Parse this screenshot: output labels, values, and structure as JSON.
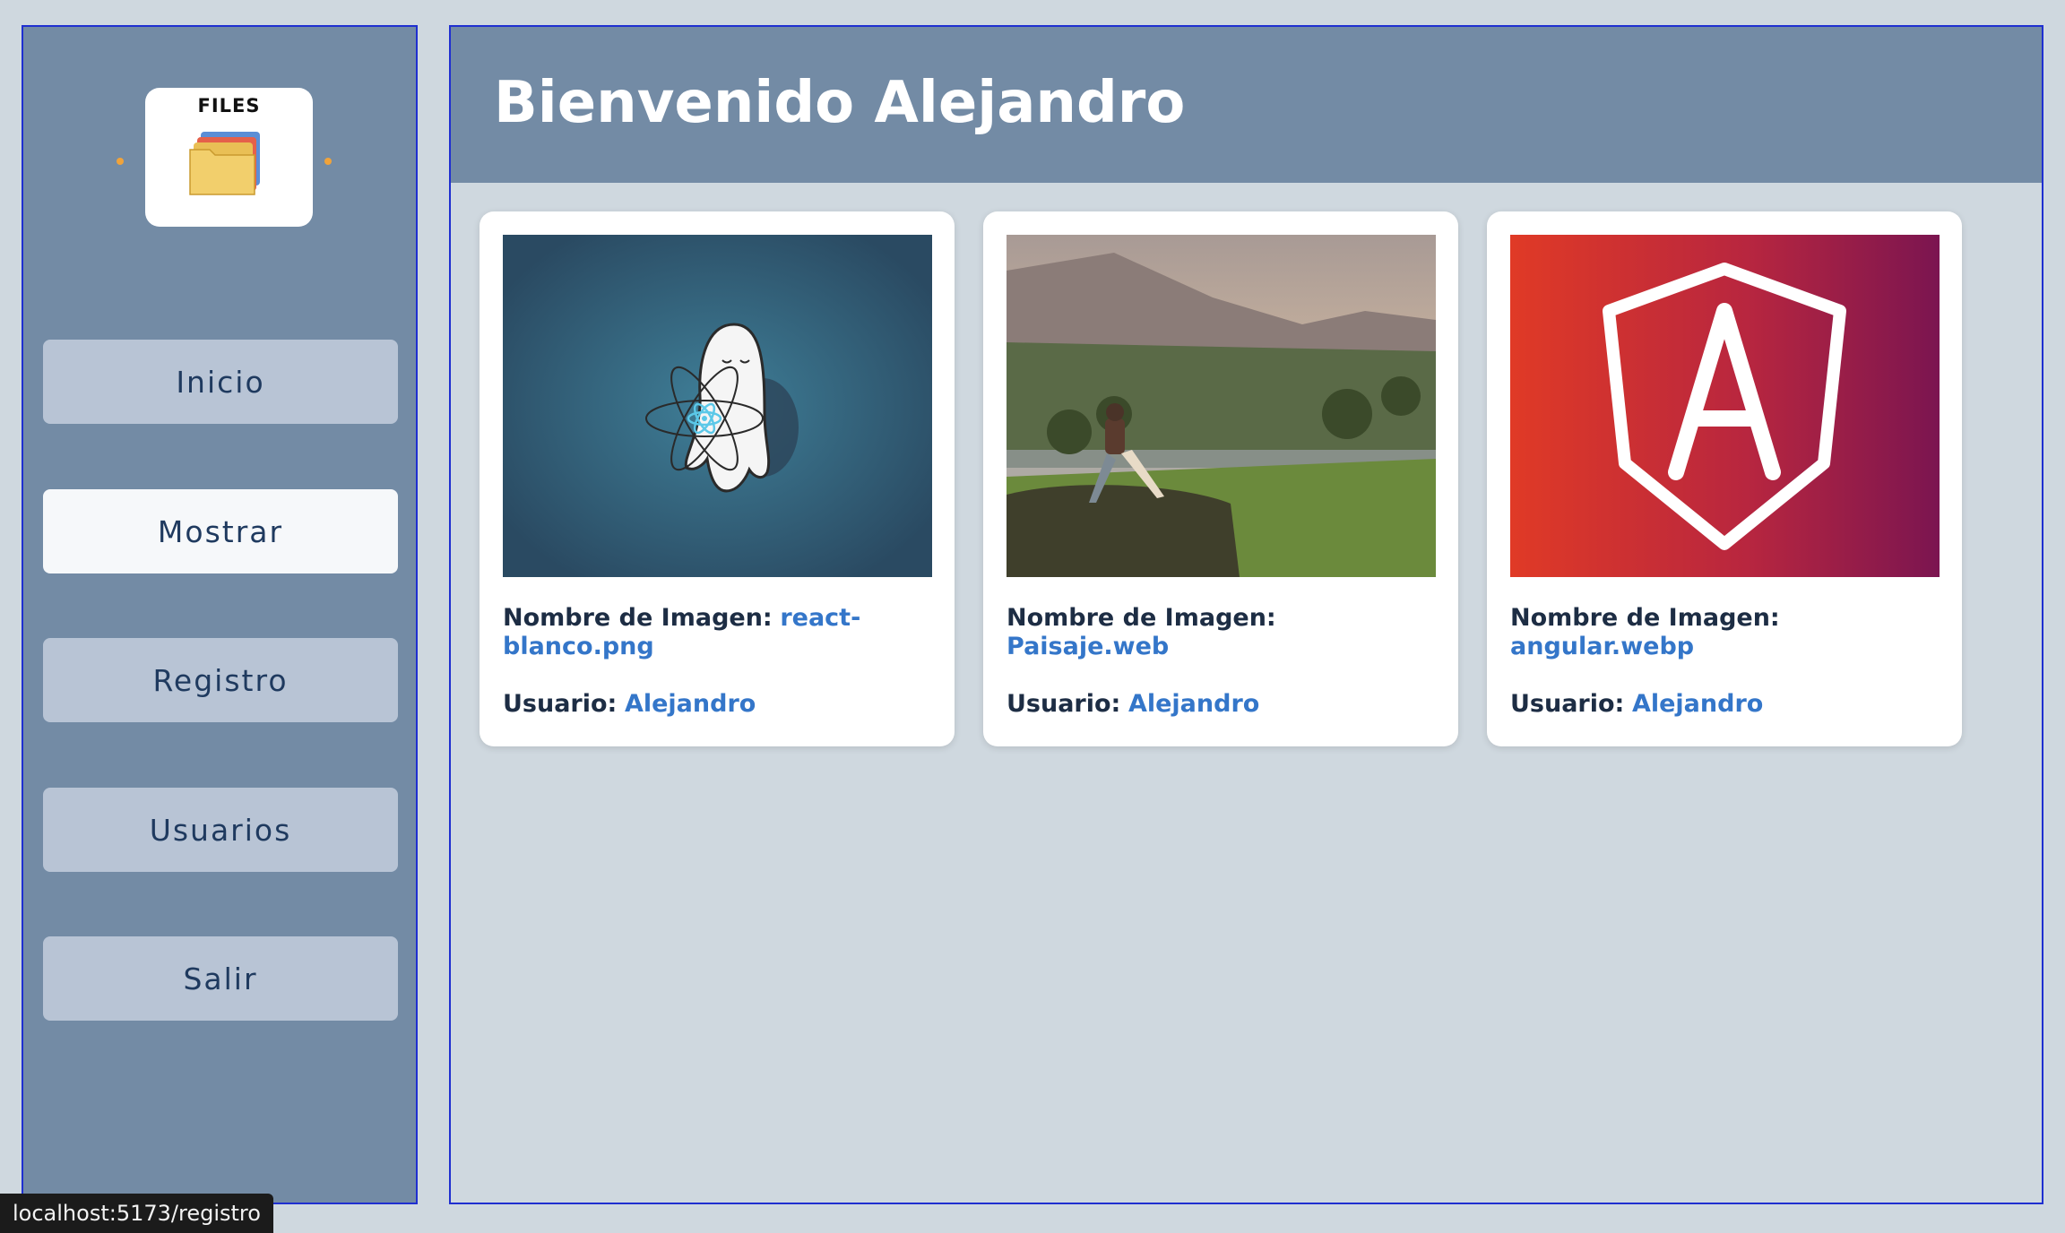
{
  "sidebar": {
    "logo_text": "FILES",
    "nav": [
      {
        "label": "Inicio"
      },
      {
        "label": "Mostrar",
        "active": true
      },
      {
        "label": "Registro"
      },
      {
        "label": "Usuarios"
      },
      {
        "label": "Salir"
      }
    ]
  },
  "header": {
    "title": "Bienvenido Alejandro"
  },
  "cards": [
    {
      "image_label": "Nombre de Imagen:",
      "image_name": "react-blanco.png",
      "user_label": "Usuario:",
      "user_name": "Alejandro"
    },
    {
      "image_label": "Nombre de Imagen:",
      "image_name": "Paisaje.web",
      "user_label": "Usuario:",
      "user_name": "Alejandro"
    },
    {
      "image_label": "Nombre de Imagen:",
      "image_name": "angular.webp",
      "user_label": "Usuario:",
      "user_name": "Alejandro"
    }
  ],
  "status_bar": {
    "url": "localhost:5173/registro"
  },
  "colors": {
    "sidebar_bg": "#738ba5",
    "nav_button": "#b8c4d5",
    "nav_button_active": "#f6f8fa",
    "link_text": "#3476c9",
    "label_text": "#1d2d44",
    "border": "#1f2fd0"
  }
}
